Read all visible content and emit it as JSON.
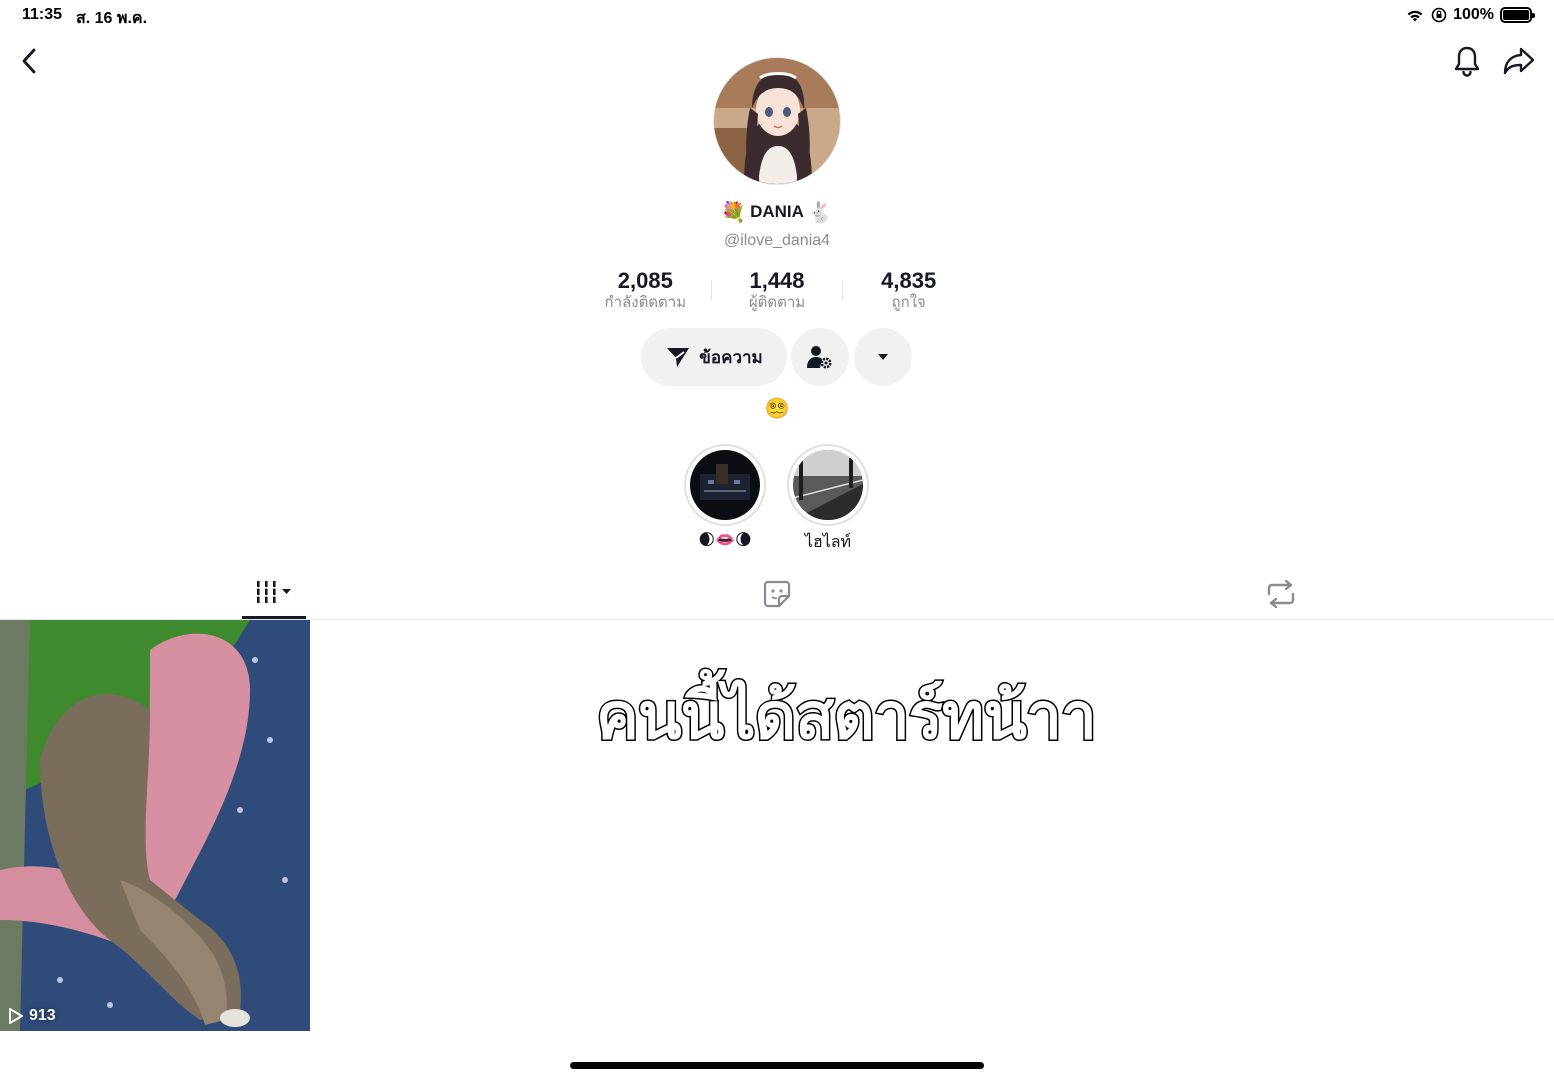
{
  "status_bar": {
    "time": "11:35",
    "date": "ส. 16 พ.ค.",
    "battery_percent": "100%",
    "battery_level": 1.0
  },
  "profile": {
    "display_name": "DANIA",
    "name_emoji_left": "💐",
    "name_emoji_right": "🐇",
    "username": "@ilove_dania4",
    "bio": "😵‍💫"
  },
  "stats": [
    {
      "value": "2,085",
      "label": "กำลังติดตาม"
    },
    {
      "value": "1,448",
      "label": "ผู้ติดตาม"
    },
    {
      "value": "4,835",
      "label": "ถูกใจ"
    }
  ],
  "actions": {
    "message_label": "ข้อความ"
  },
  "highlights": [
    {
      "label": "🌒👄🌘"
    },
    {
      "label": "ไฮไลท์"
    }
  ],
  "videos": [
    {
      "views": "913"
    }
  ],
  "overlay_caption": "คนนี้ได้สตาร์ทน้าา",
  "colors": {
    "text_primary": "#161823",
    "text_secondary": "#8a8b91",
    "button_bg": "#f1f1f2"
  }
}
